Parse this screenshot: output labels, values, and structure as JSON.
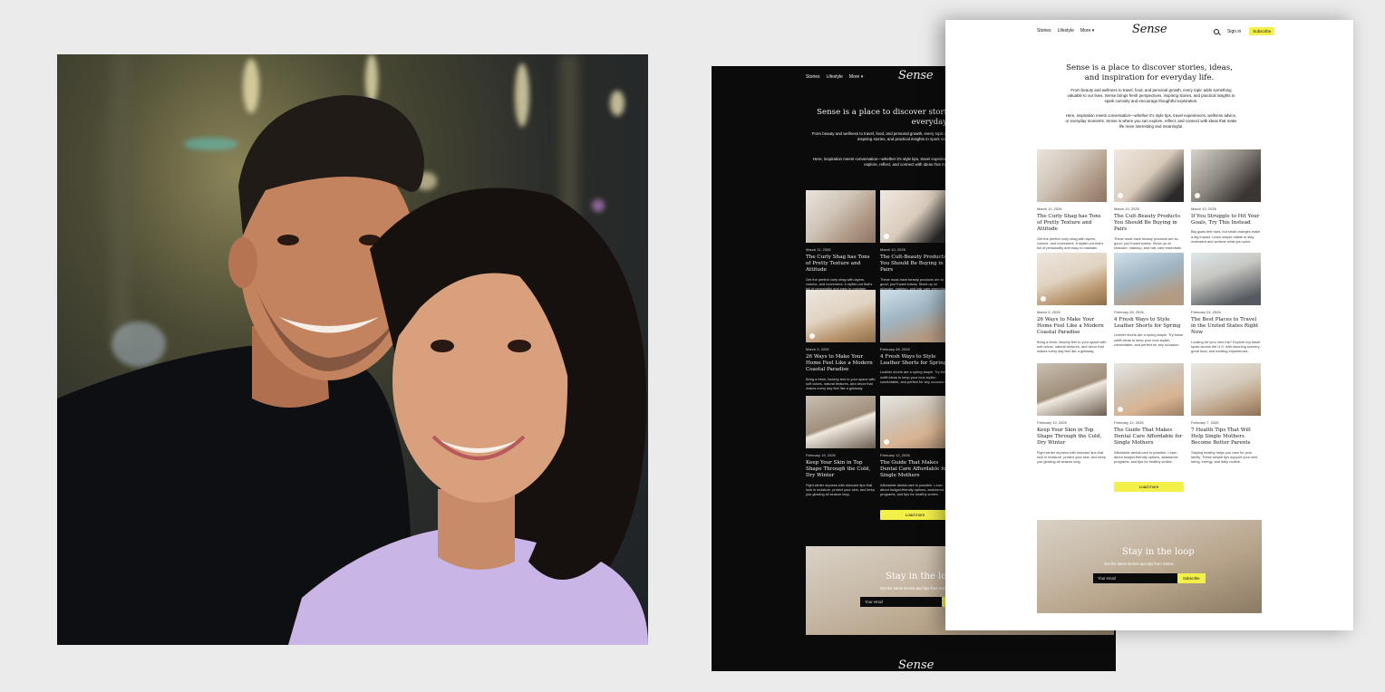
{
  "site": {
    "logo": "Sense",
    "nav": [
      "Stories",
      "Lifestyle",
      "More"
    ],
    "right_nav": {
      "signin": "Sign in",
      "subscribe": "Subscribe"
    },
    "hero_title": "Sense is a place to discover stories, ideas, and inspiration for everyday life.",
    "hero_p1": "From beauty and wellness to travel, food, and personal growth, every topic adds something valuable to our lives. Sense brings fresh perspectives, inspiring stories, and practical insights to spark curiosity and encourage thoughtful exploration.",
    "hero_p2": "Here, inspiration meets conversation—whether it's style tips, travel experiences, wellness advice, or everyday moments. Sense is where you can explore, reflect, and connect with ideas that make life more interesting and meaningful.",
    "load_more": "Load more",
    "newsletter": {
      "heading": "Stay in the loop",
      "subtext": "Get the latest stories and tips from Sense.",
      "email_placeholder": "Your email",
      "button": "Subscribe"
    }
  },
  "articles": [
    {
      "date": "March 11, 2026",
      "title": "The Curly Shag has Tons of Pretty Texture and Attitude",
      "excerpt": "Get the perfect curly shag with layers, volume, and movement. A stylish cut that's full of personality and easy to maintain."
    },
    {
      "date": "March 10, 2026",
      "title": "The Cult-Beauty Products You Should Be Buying in Pairs",
      "excerpt": "These must-have beauty products are so good, you'll want extras. Stock up on skincare, makeup, and hair care essentials."
    },
    {
      "date": "March 10, 2026",
      "title": "If You Struggle to Hit Your Goals, Try This Instead",
      "excerpt": "Big goals feel hard, but small changes make a big impact. Learn simple habits to stay motivated and achieve what you want."
    },
    {
      "date": "March 9, 2026",
      "title": "26 Ways to Make Your Home Feel Like a Modern Coastal Paradise",
      "excerpt": "Bring a fresh, beachy feel to your space with soft colors, natural textures, and decor that makes every day feel like a getaway."
    },
    {
      "date": "February 28, 2026",
      "title": "4 Fresh Ways to Style Leather Shorts for Spring",
      "excerpt": "Leather shorts are a spring staple. Try these outfit ideas to keep your look stylish, comfortable, and perfect for any occasion."
    },
    {
      "date": "February 24, 2026",
      "title": "The Best Places to Travel in the United States Right Now",
      "excerpt": "Looking for your next trip? Explore top travel spots across the U.S. with stunning scenery, great food, and exciting experiences."
    },
    {
      "date": "February 19, 2026",
      "title": "Keep Your Skin in Top Shape Through the Cold, Dry Winter",
      "excerpt": "Fight winter dryness with skincare tips that lock in moisture, protect your skin, and keep you glowing all season long."
    },
    {
      "date": "February 12, 2026",
      "title": "The Guide That Makes Dental Care Affordable for Single Mothers",
      "excerpt": "Affordable dental care is possible. Learn about budget-friendly options, assistance programs, and tips for healthy smiles."
    },
    {
      "date": "February 7, 2026",
      "title": "7 Health Tips That Will Help Single Mothers Become Better Parents",
      "excerpt": "Staying healthy helps you care for your family. These simple tips support your well-being, energy, and daily routine."
    }
  ]
}
